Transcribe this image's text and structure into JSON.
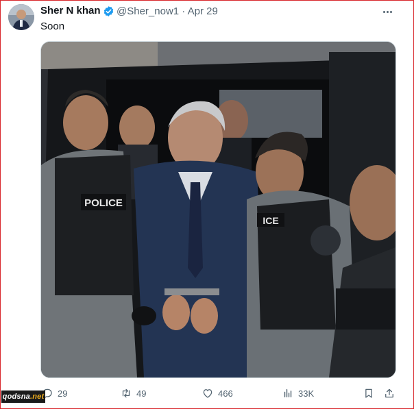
{
  "tweet": {
    "author_name": "Sher N khan",
    "handle": "@Sher_now1",
    "separator": "·",
    "date": "Apr 29",
    "text": "Soon",
    "media_description": "Image: man in dark suit and handcuffs escorted by police officers beside a black vehicle; vests read POLICE and ICE",
    "vest_text_left": "POLICE",
    "vest_text_right": "ICE"
  },
  "actions": {
    "replies": "29",
    "reposts": "49",
    "likes": "466",
    "views": "33K"
  },
  "watermark": {
    "site": "qodsna",
    "tld": ".net"
  },
  "colors": {
    "frame_border": "#d8262b",
    "verified": "#1d9bf0",
    "muted_text": "#536471",
    "primary_text": "#0f1419"
  },
  "icons": [
    "more-icon",
    "verified-icon",
    "reply-icon",
    "repost-icon",
    "like-icon",
    "views-icon",
    "bookmark-icon",
    "share-icon"
  ]
}
